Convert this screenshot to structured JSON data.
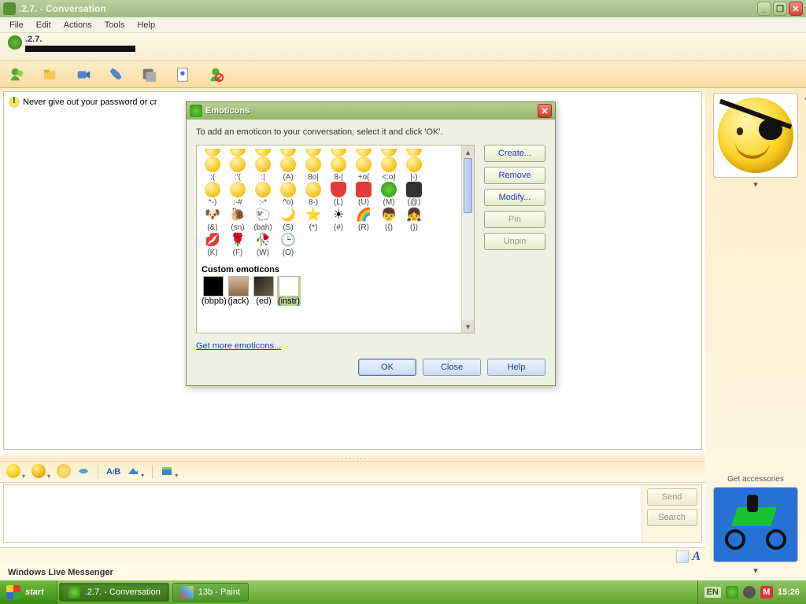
{
  "window": {
    "title": ".2.7. - Conversation"
  },
  "menu": {
    "file": "File",
    "edit": "Edit",
    "actions": "Actions",
    "tools": "Tools",
    "help": "Help"
  },
  "contact": {
    "name": ".2.7."
  },
  "conversation": {
    "warning": "Never give out your password or cr"
  },
  "compose": {
    "send": "Send",
    "search": "Search"
  },
  "branding": "Windows Live Messenger",
  "right": {
    "accessories": "Get accessories"
  },
  "dialog": {
    "title": "Emoticons",
    "instruction": "To add an emoticon to your conversation, select it and click 'OK'.",
    "buttons": {
      "create": "Create...",
      "remove": "Remove",
      "modify": "Modify...",
      "pin": "Pin",
      "unpin": "Unpin"
    },
    "row1": [
      ":(",
      ":'(",
      ":|",
      "(A)",
      "8o|",
      "8-|",
      "+o(",
      "<:o)",
      "|-)"
    ],
    "row2": [
      "*-)",
      ":-#",
      ":-*",
      "^o)",
      "8-)",
      "(L)",
      "(U)",
      "(M)",
      "(@)"
    ],
    "row3": [
      "(&)",
      "(sn)",
      "(bah)",
      "(S)",
      "(*)",
      "(#)",
      "(R)",
      "({)",
      "(})"
    ],
    "row4": [
      "(K)",
      "(F)",
      "(W)",
      "(O)"
    ],
    "custom_header": "Custom emoticons",
    "custom": [
      "(bbpb)",
      "(jack)",
      "(ed)",
      "(instr)"
    ],
    "link": "Get more emoticons...",
    "footer": {
      "ok": "OK",
      "close": "Close",
      "help": "Help"
    }
  },
  "taskbar": {
    "start": "start",
    "task1": ".2.7. - Conversation",
    "task2": "13b - Paint",
    "lang": "EN",
    "clock": "15:26"
  }
}
